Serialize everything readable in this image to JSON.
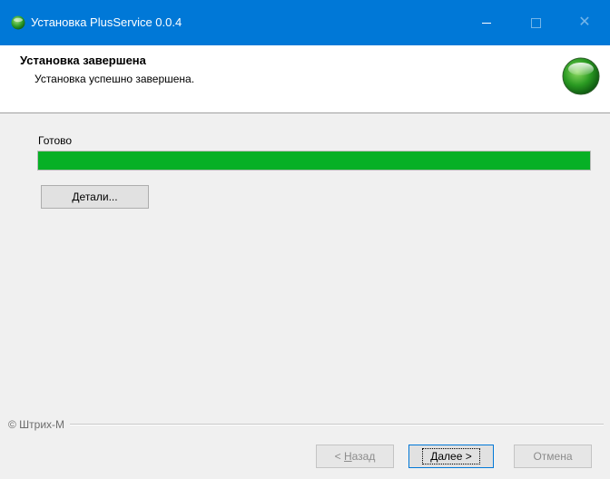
{
  "window": {
    "title": "Установка PlusService 0.0.4",
    "controls": {
      "minimize": "—",
      "maximize": "☐",
      "close": "✕"
    }
  },
  "header": {
    "title": "Установка завершена",
    "subtitle": "Установка успешно завершена.",
    "logo_icon": "green-sphere-icon"
  },
  "main": {
    "status_label": "Готово",
    "progress_fraction": 1.0,
    "progress_color": "#06b025",
    "details_button": {
      "accel": "Д",
      "rest": "етали..."
    }
  },
  "footer": {
    "brand": "© Штрих-М",
    "back_button": {
      "prefix": "< ",
      "accel": "Н",
      "rest": "азад"
    },
    "next_button": {
      "accel": "Д",
      "rest": "алее >"
    },
    "cancel_button": "Отмена"
  },
  "colors": {
    "titlebar": "#0078d7",
    "progress": "#06b025"
  }
}
